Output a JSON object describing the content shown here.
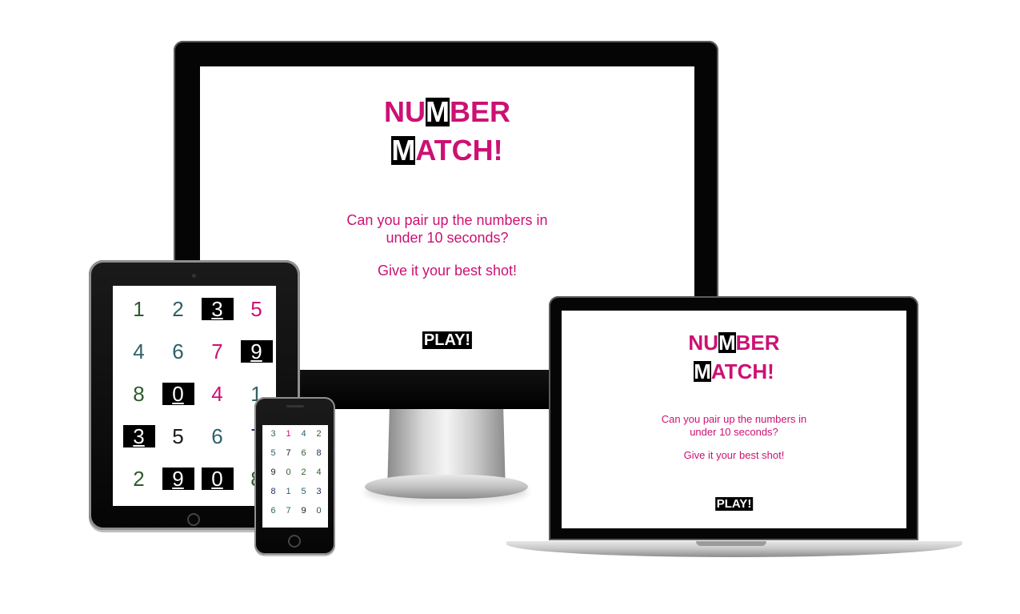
{
  "intro": {
    "title_line1_a": "NU",
    "title_line1_hl": "M",
    "title_line1_b": "BER",
    "title_line2_hl": "M",
    "title_line2_b": "ATCH!",
    "question_line1": "Can you pair up the numbers in",
    "question_line2": "under 10 seconds?",
    "encouragement": "Give it your best shot!",
    "play_label": "PLAY!"
  },
  "tablet_grid": [
    {
      "value": "1",
      "color": "green",
      "selected": false
    },
    {
      "value": "2",
      "color": "teal",
      "selected": false
    },
    {
      "value": "3",
      "color": "dark",
      "selected": true
    },
    {
      "value": "5",
      "color": "pink",
      "selected": false
    },
    {
      "value": "4",
      "color": "teal",
      "selected": false
    },
    {
      "value": "6",
      "color": "teal",
      "selected": false
    },
    {
      "value": "7",
      "color": "pink",
      "selected": false
    },
    {
      "value": "9",
      "color": "dark",
      "selected": true
    },
    {
      "value": "8",
      "color": "green",
      "selected": false
    },
    {
      "value": "0",
      "color": "dark",
      "selected": true
    },
    {
      "value": "4",
      "color": "pink",
      "selected": false
    },
    {
      "value": "1",
      "color": "teal",
      "selected": false
    },
    {
      "value": "3",
      "color": "dark",
      "selected": true
    },
    {
      "value": "5",
      "color": "dark",
      "selected": false
    },
    {
      "value": "6",
      "color": "teal",
      "selected": false
    },
    {
      "value": "7",
      "color": "navy",
      "selected": false
    },
    {
      "value": "2",
      "color": "green",
      "selected": false
    },
    {
      "value": "9",
      "color": "dark",
      "selected": true
    },
    {
      "value": "0",
      "color": "dark",
      "selected": true
    },
    {
      "value": "8",
      "color": "green",
      "selected": false
    }
  ],
  "phone_grid": [
    {
      "value": "3",
      "color": "teal"
    },
    {
      "value": "1",
      "color": "pink"
    },
    {
      "value": "4",
      "color": "teal"
    },
    {
      "value": "2",
      "color": "green"
    },
    {
      "value": "5",
      "color": "teal"
    },
    {
      "value": "7",
      "color": "dark"
    },
    {
      "value": "6",
      "color": "green"
    },
    {
      "value": "8",
      "color": "navy"
    },
    {
      "value": "9",
      "color": "dark"
    },
    {
      "value": "0",
      "color": "green"
    },
    {
      "value": "2",
      "color": "green"
    },
    {
      "value": "4",
      "color": "green"
    },
    {
      "value": "8",
      "color": "navy"
    },
    {
      "value": "1",
      "color": "teal"
    },
    {
      "value": "5",
      "color": "teal"
    },
    {
      "value": "3",
      "color": "navy"
    },
    {
      "value": "6",
      "color": "teal"
    },
    {
      "value": "7",
      "color": "teal"
    },
    {
      "value": "9",
      "color": "dark"
    },
    {
      "value": "0",
      "color": "green"
    }
  ],
  "colors": {
    "accent": "#cc1173",
    "green": "#2f5a2f",
    "teal": "#2f6166",
    "pink": "#cc1173",
    "dark": "#1a1a1a",
    "navy": "#1f2b5f"
  }
}
